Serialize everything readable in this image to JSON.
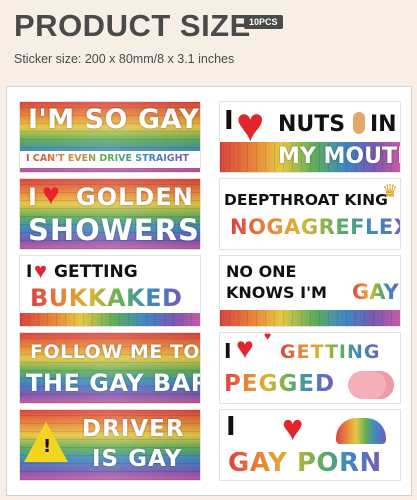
{
  "header": {
    "title": "PRODUCT SIZE",
    "badge": "10PCS",
    "size_line": "Sticker size: 200 x 80mm/8 x 3.1 inches"
  },
  "stickers": {
    "s1": {
      "line1": "I'M SO GAY",
      "line2": "I CAN'T EVEN DRIVE STRAIGHT"
    },
    "s2": {
      "pre": "I",
      "heart": "♥",
      "word1": "NUTS",
      "word2": "IN",
      "line2": "MY MOUTH"
    },
    "s3": {
      "pre": "I",
      "heart": "♥",
      "word1": "GOLDEN",
      "line2": "SHOWERS"
    },
    "s4": {
      "line1": "DEEPTHROAT KING",
      "line2": "NOGAGREFLEX",
      "crown": "♛"
    },
    "s5": {
      "pre": "I",
      "heart": "♥",
      "word1": "GETTING",
      "line2": "BUKKAKED"
    },
    "s6": {
      "line1": "NO ONE",
      "line2a": "KNOWS I'M",
      "line2b": "GAY"
    },
    "s7": {
      "line1": "FOLLOW ME TO",
      "line2": "THE GAY BAR"
    },
    "s8": {
      "pre": "I",
      "heart": "♥",
      "word1": "GETTING",
      "line2": "PEGGED"
    },
    "s9": {
      "warn": "!",
      "line1": "DRIVER",
      "line2": "IS GAY"
    },
    "s10": {
      "pre": "I",
      "heart": "♥",
      "line2": "GAY PORN"
    }
  },
  "colors": {
    "title": "#4a4a4a",
    "background": "#f7efe6",
    "heart": "#e3242b",
    "warning": "#f2d51e"
  }
}
